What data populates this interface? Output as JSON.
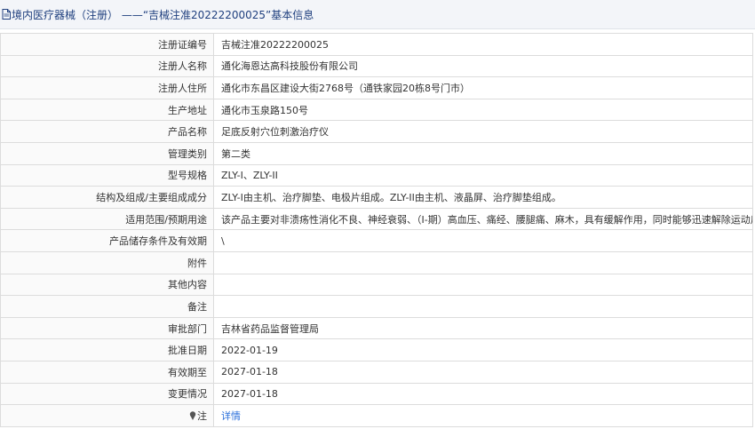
{
  "header": {
    "title": "境内医疗器械（注册） ——“吉械注准20222200025”基本信息",
    "icon": "document-icon"
  },
  "rows": [
    {
      "label": "注册证编号",
      "value": "吉械注准20222200025"
    },
    {
      "label": "注册人名称",
      "value": "通化海恩达高科技股份有限公司"
    },
    {
      "label": "注册人住所",
      "value": "通化市东昌区建设大街2768号（通铁家园20栋8号门市）"
    },
    {
      "label": "生产地址",
      "value": "通化市玉泉路150号"
    },
    {
      "label": "产品名称",
      "value": "足底反射穴位刺激治疗仪"
    },
    {
      "label": "管理类别",
      "value": "第二类"
    },
    {
      "label": "型号规格",
      "value": "ZLY-I、ZLY-II"
    },
    {
      "label": "结构及组成/主要组成成分",
      "value": "ZLY-I由主机、治疗脚垫、电极片组成。ZLY-II由主机、液晶屏、治疗脚垫组成。"
    },
    {
      "label": "适用范围/预期用途",
      "value": "该产品主要对非溃疡性消化不良、神经衰弱、（I-期）高血压、痛经、腰腿痛、麻木，具有缓解作用，同时能够迅速解除运动后疲劳。"
    },
    {
      "label": "产品储存条件及有效期",
      "value": "\\"
    },
    {
      "label": "附件",
      "value": ""
    },
    {
      "label": "其他内容",
      "value": ""
    },
    {
      "label": "备注",
      "value": ""
    },
    {
      "label": "审批部门",
      "value": "吉林省药品监督管理局"
    },
    {
      "label": "批准日期",
      "value": "2022-01-19"
    },
    {
      "label": "有效期至",
      "value": "2027-01-18"
    },
    {
      "label": "变更情况",
      "value": "2027-01-18"
    }
  ],
  "note_row": {
    "label": "注",
    "icon": "pin-icon",
    "link": "详情"
  },
  "colors": {
    "header_text": "#20407f",
    "header_bg": "#f3f5f9",
    "border": "#dcdcdc",
    "link": "#2a6fdb"
  }
}
